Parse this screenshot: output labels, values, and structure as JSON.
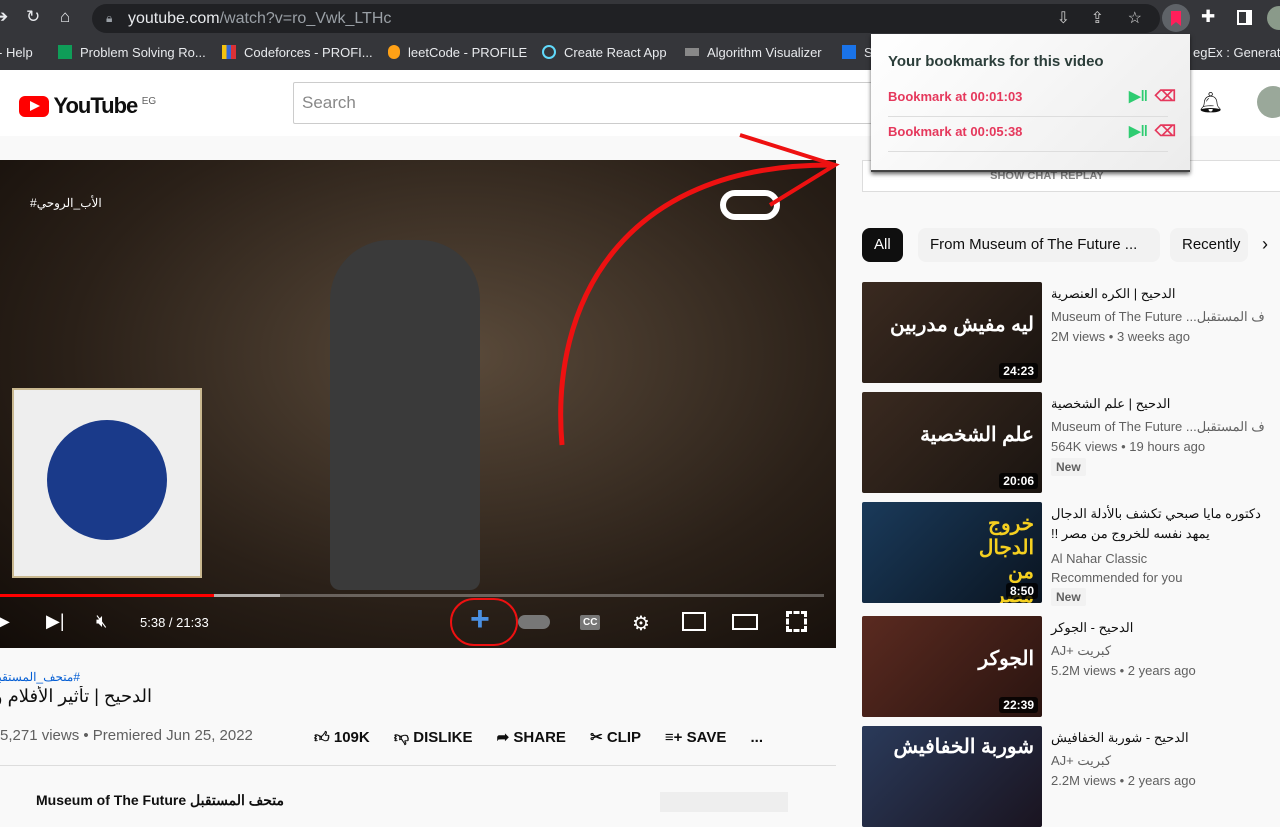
{
  "browser": {
    "url_host": "youtube.com",
    "url_path": "/watch?v=ro_Vwk_LTHc",
    "bookmarks": [
      {
        "label": "- Help",
        "icon": "page-icon"
      },
      {
        "label": "Problem Solving Ro...",
        "icon": "sheets-icon"
      },
      {
        "label": "Codeforces - PROFI...",
        "icon": "codeforces-icon"
      },
      {
        "label": "leetCode - PROFILE",
        "icon": "leetcode-icon"
      },
      {
        "label": "Create React App",
        "icon": "react-icon"
      },
      {
        "label": "Algorithm Visualizer",
        "icon": "page-icon"
      },
      {
        "label": "S",
        "icon": "bluetooth-icon"
      },
      {
        "label": "egEx : Generator",
        "icon": "page-icon"
      }
    ]
  },
  "extension_popup": {
    "title": "Your bookmarks for this video",
    "items": [
      {
        "label": "Bookmark at 00:01:03"
      },
      {
        "label": "Bookmark at 00:05:38"
      }
    ],
    "accent": "#e5385c",
    "play_color": "#2ecc71"
  },
  "youtube": {
    "logo": "YouTube",
    "region": "EG",
    "search_placeholder": "Search",
    "chat_replay": "SHOW CHAT REPLAY",
    "player": {
      "time": "5:38 / 21:33",
      "progress_percent": 26,
      "buffered_percent": 34,
      "watermark_text": "#الأب_الروحي"
    },
    "video": {
      "hashtag": "#متحف_المستقبل #",
      "title": "الدحيح | تأثير الأفلام والأ",
      "views": "5,271 views • Premiered Jun 25, 2022",
      "channel": "Museum of The Future متحف المستقبل"
    },
    "actions": {
      "likes": "109K",
      "dislike": "DISLIKE",
      "share": "SHARE",
      "clip": "CLIP",
      "save": "SAVE",
      "more": "..."
    },
    "chips": [
      "All",
      "From Museum of The Future ...",
      "Recently"
    ],
    "recommendations": [
      {
        "title": "الدحيح | الكره العنصرية",
        "channel": "Museum of The Future ...ف المستقبل",
        "meta": "2M views • 3 weeks ago",
        "duration": "24:23",
        "thumb_text": "ليه مفيش مدربين",
        "badge": ""
      },
      {
        "title": "الدحيح | علم الشخصية",
        "channel": "Museum of The Future ...ف المستقبل",
        "meta": "564K views • 19 hours ago",
        "duration": "20:06",
        "thumb_text": "علم الشخصية",
        "badge": "New"
      },
      {
        "title": "دكتوره مايا صبحي تكشف بالأدلة الدجال يمهد نفسه للخروج من مصر !!",
        "channel": "Al Nahar Classic",
        "meta": "Recommended for you",
        "duration": "8:50",
        "thumb_text": "خروج الدجال من مصر",
        "badge": "New"
      },
      {
        "title": "الدحيح - الجوكر",
        "channel": "AJ+ كبريت",
        "meta": "5.2M views • 2 years ago",
        "duration": "22:39",
        "thumb_text": "الجوكر",
        "badge": ""
      },
      {
        "title": "الدحيح - شوربة الخفافيش",
        "channel": "AJ+ كبريت",
        "meta": "2.2M views • 2 years ago",
        "duration": "",
        "thumb_text": "شوربة الخفافيش",
        "badge": ""
      }
    ]
  }
}
